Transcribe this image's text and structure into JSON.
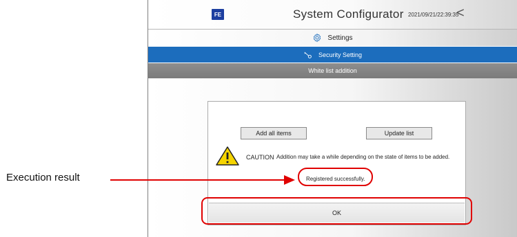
{
  "header": {
    "logo_text": "FE",
    "title": "System Configurator",
    "datetime": "2021/09/21/22:39:35",
    "back_glyph": "<"
  },
  "nav": {
    "settings_label": "Settings",
    "security_label": "Security Setting",
    "whitelist_label": "White list addition"
  },
  "dialog": {
    "add_all_label": "Add all items",
    "update_label": "Update list",
    "caution_label": "CAUTION",
    "caution_text": "Addition may take a while depending on the state of items to be added.",
    "result_text": "Registered successfully.",
    "ok_label": "OK"
  },
  "annotation": {
    "label": "Execution result",
    "color": "#e00000"
  },
  "colors": {
    "security_bar": "#1c6dbd",
    "whitelist_bar": "#7b7b7b",
    "logo": "#1d3fa0"
  },
  "icons": {
    "settings": "gear-icon",
    "security": "key-icon",
    "warning": "warning-triangle-icon",
    "back": "chevron-left-icon"
  }
}
